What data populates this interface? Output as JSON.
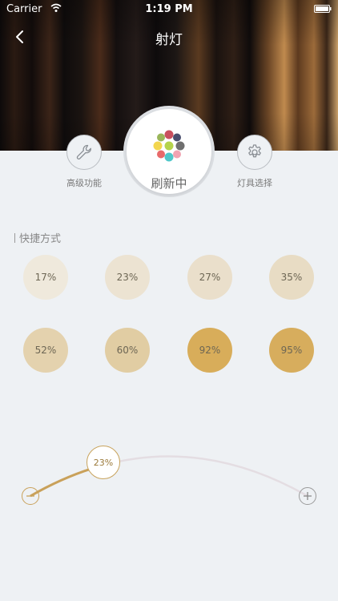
{
  "status_bar": {
    "carrier": "Carrier",
    "time": "1:19 PM"
  },
  "nav": {
    "title": "射灯",
    "back_icon": "chevron-left-icon"
  },
  "main_button": {
    "label": "刷新中",
    "icon": "color-flower-icon"
  },
  "side_buttons": [
    {
      "label": "高级功能",
      "icon": "wrench-icon"
    },
    {
      "label": "灯具选择",
      "icon": "gear-icon"
    }
  ],
  "section": {
    "title": "快捷方式"
  },
  "presets": [
    {
      "label": "17%",
      "color": "#efe9dc"
    },
    {
      "label": "23%",
      "color": "#ece3d2"
    },
    {
      "label": "27%",
      "color": "#eadfcb"
    },
    {
      "label": "35%",
      "color": "#e8dcc4"
    },
    {
      "label": "52%",
      "color": "#e4d2ae"
    },
    {
      "label": "60%",
      "color": "#e1cda3"
    },
    {
      "label": "92%",
      "color": "#d8ad5a"
    },
    {
      "label": "95%",
      "color": "#d7ad5d"
    }
  ],
  "slider": {
    "value_label": "23%",
    "value": 0.23,
    "min_icon": "minus-circle-icon",
    "max_icon": "plus-circle-icon",
    "active_color": "#c9a15a",
    "track_color": "#e4dde2"
  }
}
